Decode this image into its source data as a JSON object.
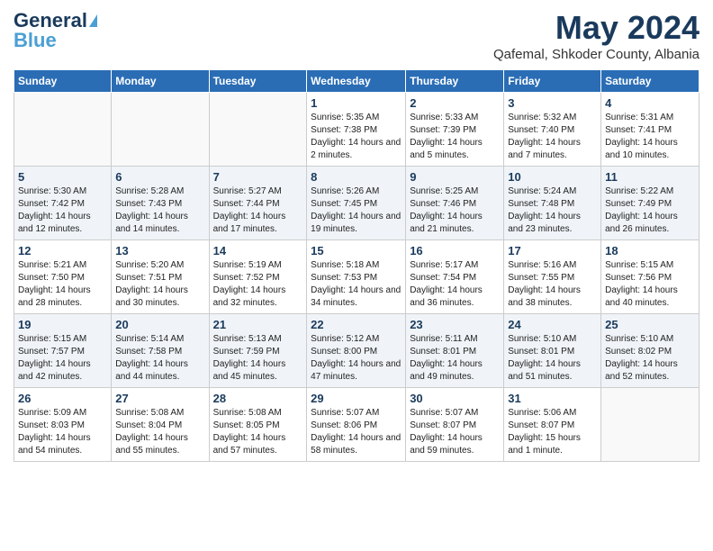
{
  "header": {
    "logo_general": "General",
    "logo_blue": "Blue",
    "month_title": "May 2024",
    "location": "Qafemal, Shkoder County, Albania"
  },
  "calendar": {
    "days_of_week": [
      "Sunday",
      "Monday",
      "Tuesday",
      "Wednesday",
      "Thursday",
      "Friday",
      "Saturday"
    ],
    "weeks": [
      [
        {
          "day": "",
          "info": ""
        },
        {
          "day": "",
          "info": ""
        },
        {
          "day": "",
          "info": ""
        },
        {
          "day": "1",
          "info": "Sunrise: 5:35 AM\nSunset: 7:38 PM\nDaylight: 14 hours and 2 minutes."
        },
        {
          "day": "2",
          "info": "Sunrise: 5:33 AM\nSunset: 7:39 PM\nDaylight: 14 hours and 5 minutes."
        },
        {
          "day": "3",
          "info": "Sunrise: 5:32 AM\nSunset: 7:40 PM\nDaylight: 14 hours and 7 minutes."
        },
        {
          "day": "4",
          "info": "Sunrise: 5:31 AM\nSunset: 7:41 PM\nDaylight: 14 hours and 10 minutes."
        }
      ],
      [
        {
          "day": "5",
          "info": "Sunrise: 5:30 AM\nSunset: 7:42 PM\nDaylight: 14 hours and 12 minutes."
        },
        {
          "day": "6",
          "info": "Sunrise: 5:28 AM\nSunset: 7:43 PM\nDaylight: 14 hours and 14 minutes."
        },
        {
          "day": "7",
          "info": "Sunrise: 5:27 AM\nSunset: 7:44 PM\nDaylight: 14 hours and 17 minutes."
        },
        {
          "day": "8",
          "info": "Sunrise: 5:26 AM\nSunset: 7:45 PM\nDaylight: 14 hours and 19 minutes."
        },
        {
          "day": "9",
          "info": "Sunrise: 5:25 AM\nSunset: 7:46 PM\nDaylight: 14 hours and 21 minutes."
        },
        {
          "day": "10",
          "info": "Sunrise: 5:24 AM\nSunset: 7:48 PM\nDaylight: 14 hours and 23 minutes."
        },
        {
          "day": "11",
          "info": "Sunrise: 5:22 AM\nSunset: 7:49 PM\nDaylight: 14 hours and 26 minutes."
        }
      ],
      [
        {
          "day": "12",
          "info": "Sunrise: 5:21 AM\nSunset: 7:50 PM\nDaylight: 14 hours and 28 minutes."
        },
        {
          "day": "13",
          "info": "Sunrise: 5:20 AM\nSunset: 7:51 PM\nDaylight: 14 hours and 30 minutes."
        },
        {
          "day": "14",
          "info": "Sunrise: 5:19 AM\nSunset: 7:52 PM\nDaylight: 14 hours and 32 minutes."
        },
        {
          "day": "15",
          "info": "Sunrise: 5:18 AM\nSunset: 7:53 PM\nDaylight: 14 hours and 34 minutes."
        },
        {
          "day": "16",
          "info": "Sunrise: 5:17 AM\nSunset: 7:54 PM\nDaylight: 14 hours and 36 minutes."
        },
        {
          "day": "17",
          "info": "Sunrise: 5:16 AM\nSunset: 7:55 PM\nDaylight: 14 hours and 38 minutes."
        },
        {
          "day": "18",
          "info": "Sunrise: 5:15 AM\nSunset: 7:56 PM\nDaylight: 14 hours and 40 minutes."
        }
      ],
      [
        {
          "day": "19",
          "info": "Sunrise: 5:15 AM\nSunset: 7:57 PM\nDaylight: 14 hours and 42 minutes."
        },
        {
          "day": "20",
          "info": "Sunrise: 5:14 AM\nSunset: 7:58 PM\nDaylight: 14 hours and 44 minutes."
        },
        {
          "day": "21",
          "info": "Sunrise: 5:13 AM\nSunset: 7:59 PM\nDaylight: 14 hours and 45 minutes."
        },
        {
          "day": "22",
          "info": "Sunrise: 5:12 AM\nSunset: 8:00 PM\nDaylight: 14 hours and 47 minutes."
        },
        {
          "day": "23",
          "info": "Sunrise: 5:11 AM\nSunset: 8:01 PM\nDaylight: 14 hours and 49 minutes."
        },
        {
          "day": "24",
          "info": "Sunrise: 5:10 AM\nSunset: 8:01 PM\nDaylight: 14 hours and 51 minutes."
        },
        {
          "day": "25",
          "info": "Sunrise: 5:10 AM\nSunset: 8:02 PM\nDaylight: 14 hours and 52 minutes."
        }
      ],
      [
        {
          "day": "26",
          "info": "Sunrise: 5:09 AM\nSunset: 8:03 PM\nDaylight: 14 hours and 54 minutes."
        },
        {
          "day": "27",
          "info": "Sunrise: 5:08 AM\nSunset: 8:04 PM\nDaylight: 14 hours and 55 minutes."
        },
        {
          "day": "28",
          "info": "Sunrise: 5:08 AM\nSunset: 8:05 PM\nDaylight: 14 hours and 57 minutes."
        },
        {
          "day": "29",
          "info": "Sunrise: 5:07 AM\nSunset: 8:06 PM\nDaylight: 14 hours and 58 minutes."
        },
        {
          "day": "30",
          "info": "Sunrise: 5:07 AM\nSunset: 8:07 PM\nDaylight: 14 hours and 59 minutes."
        },
        {
          "day": "31",
          "info": "Sunrise: 5:06 AM\nSunset: 8:07 PM\nDaylight: 15 hours and 1 minute."
        },
        {
          "day": "",
          "info": ""
        }
      ]
    ]
  }
}
